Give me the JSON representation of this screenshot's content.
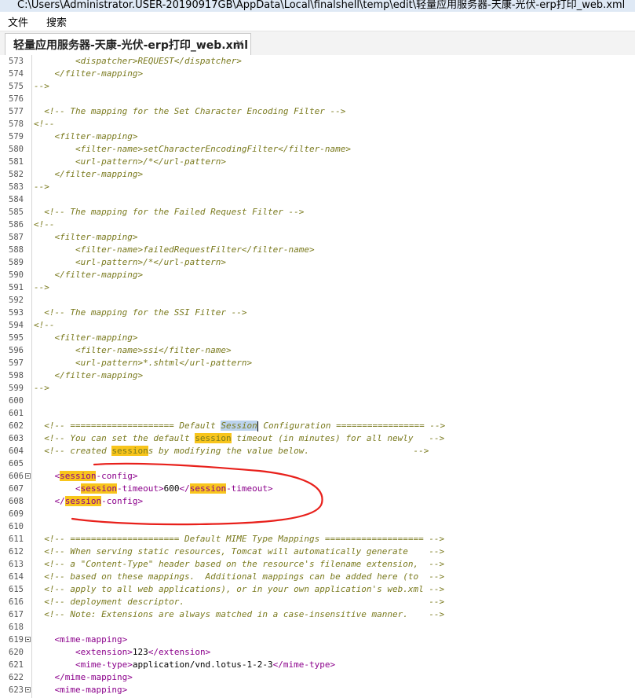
{
  "window": {
    "title": "C:\\Users\\Administrator.USER-20190917GB\\AppData\\Local\\finalshell\\temp\\edit\\轻量应用服务器-天康-光伏-erp打印_web.xml"
  },
  "menu": {
    "items": [
      "文件",
      "搜索"
    ]
  },
  "tab": {
    "label": "轻量应用服务器-天康-光伏-erp打印_web.xml",
    "close": "×"
  },
  "editor": {
    "lines": [
      {
        "n": "573",
        "segs": [
          {
            "t": "        <dispatcher>REQUEST</dispatcher>"
          }
        ]
      },
      {
        "n": "574",
        "segs": [
          {
            "t": "    </filter-mapping>"
          }
        ]
      },
      {
        "n": "575",
        "segs": [
          {
            "t": "-->"
          }
        ]
      },
      {
        "n": "576",
        "segs": [
          {
            "t": ""
          }
        ]
      },
      {
        "n": "577",
        "segs": [
          {
            "t": "  <!-- The mapping for the Set Character Encoding Filter -->"
          }
        ]
      },
      {
        "n": "578",
        "segs": [
          {
            "t": "<!--"
          }
        ]
      },
      {
        "n": "579",
        "segs": [
          {
            "t": "    <filter-mapping>"
          }
        ]
      },
      {
        "n": "580",
        "segs": [
          {
            "t": "        <filter-name>setCharacterEncodingFilter</filter-name>"
          }
        ]
      },
      {
        "n": "581",
        "segs": [
          {
            "t": "        <url-pattern>/*</url-pattern>"
          }
        ]
      },
      {
        "n": "582",
        "segs": [
          {
            "t": "    </filter-mapping>"
          }
        ]
      },
      {
        "n": "583",
        "segs": [
          {
            "t": "-->"
          }
        ]
      },
      {
        "n": "584",
        "segs": [
          {
            "t": ""
          }
        ]
      },
      {
        "n": "585",
        "segs": [
          {
            "t": "  <!-- The mapping for the Failed Request Filter -->"
          }
        ]
      },
      {
        "n": "586",
        "segs": [
          {
            "t": "<!--"
          }
        ]
      },
      {
        "n": "587",
        "segs": [
          {
            "t": "    <filter-mapping>"
          }
        ]
      },
      {
        "n": "588",
        "segs": [
          {
            "t": "        <filter-name>failedRequestFilter</filter-name>"
          }
        ]
      },
      {
        "n": "589",
        "segs": [
          {
            "t": "        <url-pattern>/*</url-pattern>"
          }
        ]
      },
      {
        "n": "590",
        "segs": [
          {
            "t": "    </filter-mapping>"
          }
        ]
      },
      {
        "n": "591",
        "segs": [
          {
            "t": "-->"
          }
        ]
      },
      {
        "n": "592",
        "segs": [
          {
            "t": ""
          }
        ]
      },
      {
        "n": "593",
        "segs": [
          {
            "t": "  <!-- The mapping for the SSI Filter -->"
          }
        ]
      },
      {
        "n": "594",
        "segs": [
          {
            "t": "<!--"
          }
        ]
      },
      {
        "n": "595",
        "segs": [
          {
            "t": "    <filter-mapping>"
          }
        ]
      },
      {
        "n": "596",
        "segs": [
          {
            "t": "        <filter-name>ssi</filter-name>"
          }
        ]
      },
      {
        "n": "597",
        "segs": [
          {
            "t": "        <url-pattern>*.shtml</url-pattern>"
          }
        ]
      },
      {
        "n": "598",
        "segs": [
          {
            "t": "    </filter-mapping>"
          }
        ]
      },
      {
        "n": "599",
        "segs": [
          {
            "t": "-->"
          }
        ]
      },
      {
        "n": "600",
        "segs": [
          {
            "t": ""
          }
        ]
      },
      {
        "n": "601",
        "segs": [
          {
            "t": ""
          }
        ]
      },
      {
        "n": "602",
        "segs": [
          {
            "t": "  <!-- ==================== Default "
          },
          {
            "t": "Session",
            "h": "sel"
          },
          {
            "t": "",
            "h": "cursor"
          },
          {
            "t": " Configuration ================= -->"
          }
        ]
      },
      {
        "n": "603",
        "segs": [
          {
            "t": "  <!-- You can set the default "
          },
          {
            "t": "session",
            "h": "find"
          },
          {
            "t": " timeout (in minutes) for all newly   -->"
          }
        ]
      },
      {
        "n": "604",
        "segs": [
          {
            "t": "  <!-- created "
          },
          {
            "t": "session",
            "h": "find"
          },
          {
            "t": "s by modifying the value below.                    -->"
          }
        ]
      },
      {
        "n": "605",
        "segs": [
          {
            "t": ""
          }
        ]
      },
      {
        "n": "606",
        "fold": true,
        "kind": "tag",
        "segs": [
          {
            "t": "    <"
          },
          {
            "t": "session",
            "h": "find"
          },
          {
            "t": "-config>"
          }
        ]
      },
      {
        "n": "607",
        "kind": "tag",
        "segs": [
          {
            "t": "        <"
          },
          {
            "t": "session",
            "h": "find"
          },
          {
            "t": "-timeout>"
          },
          {
            "t": "600",
            "k": "text"
          },
          {
            "t": "</"
          },
          {
            "t": "session",
            "h": "find"
          },
          {
            "t": "-timeout>"
          }
        ]
      },
      {
        "n": "608",
        "kind": "tag",
        "segs": [
          {
            "t": "    </"
          },
          {
            "t": "session",
            "h": "find"
          },
          {
            "t": "-config>"
          }
        ]
      },
      {
        "n": "609",
        "segs": [
          {
            "t": ""
          }
        ]
      },
      {
        "n": "610",
        "segs": [
          {
            "t": ""
          }
        ]
      },
      {
        "n": "611",
        "segs": [
          {
            "t": "  <!-- ===================== Default MIME Type Mappings =================== -->"
          }
        ]
      },
      {
        "n": "612",
        "segs": [
          {
            "t": "  <!-- When serving static resources, Tomcat will automatically generate    -->"
          }
        ]
      },
      {
        "n": "613",
        "segs": [
          {
            "t": "  <!-- a \"Content-Type\" header based on the resource's filename extension,  -->"
          }
        ]
      },
      {
        "n": "614",
        "segs": [
          {
            "t": "  <!-- based on these mappings.  Additional mappings can be added here (to  -->"
          }
        ]
      },
      {
        "n": "615",
        "segs": [
          {
            "t": "  <!-- apply to all web applications), or in your own application's web.xml -->"
          }
        ]
      },
      {
        "n": "616",
        "segs": [
          {
            "t": "  <!-- deployment descriptor.                                               -->"
          }
        ]
      },
      {
        "n": "617",
        "segs": [
          {
            "t": "  <!-- Note: Extensions are always matched in a case-insensitive manner.    -->"
          }
        ]
      },
      {
        "n": "618",
        "segs": [
          {
            "t": ""
          }
        ]
      },
      {
        "n": "619",
        "fold": true,
        "kind": "tag",
        "segs": [
          {
            "t": "    <mime-mapping>"
          }
        ]
      },
      {
        "n": "620",
        "kind": "tag",
        "segs": [
          {
            "t": "        <extension>"
          },
          {
            "t": "123",
            "k": "text"
          },
          {
            "t": "</extension>"
          }
        ]
      },
      {
        "n": "621",
        "kind": "tag",
        "segs": [
          {
            "t": "        <mime-type>"
          },
          {
            "t": "application/vnd.lotus-1-2-3",
            "k": "text"
          },
          {
            "t": "</mime-type>"
          }
        ]
      },
      {
        "n": "622",
        "kind": "tag",
        "segs": [
          {
            "t": "    </mime-mapping>"
          }
        ]
      },
      {
        "n": "623",
        "fold": true,
        "kind": "tag",
        "segs": [
          {
            "t": "    <mime-mapping>"
          }
        ]
      }
    ]
  },
  "colors": {
    "comment": "#7a7a1e",
    "tag": "#8b008b",
    "find_highlight": "#f8c51c",
    "selection": "#bcd3ee",
    "annotation": "#e8201b"
  }
}
